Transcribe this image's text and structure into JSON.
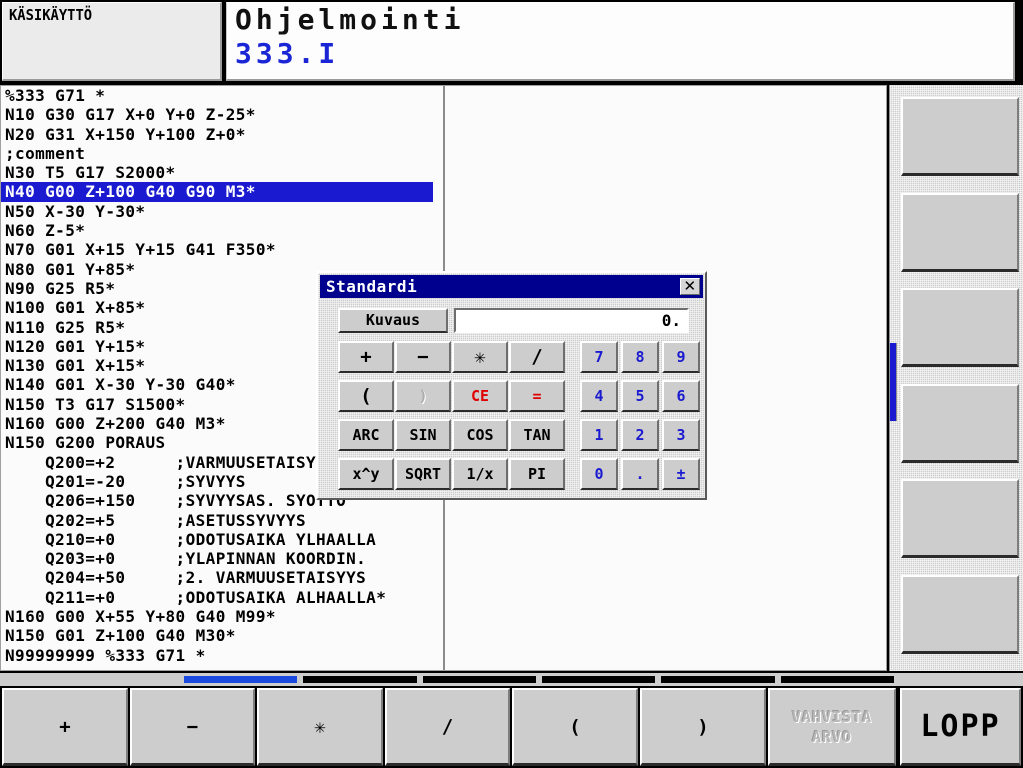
{
  "header": {
    "mode_label": "KÄSIKÄYTTÖ",
    "title": "Ohjelmointi",
    "subtitle": "333.I"
  },
  "program": {
    "lines": [
      {
        "text": "%333 G71 *",
        "selected": false
      },
      {
        "text": "N10 G30 G17 X+0 Y+0 Z-25*",
        "selected": false
      },
      {
        "text": "N20 G31 X+150 Y+100 Z+0*",
        "selected": false
      },
      {
        "text": ";comment",
        "selected": false
      },
      {
        "text": "N30 T5 G17 S2000*",
        "selected": false
      },
      {
        "text": "N40 G00 Z+100 G40 G90 M3*",
        "selected": true
      },
      {
        "text": "N50 X-30 Y-30*",
        "selected": false
      },
      {
        "text": "N60 Z-5*",
        "selected": false
      },
      {
        "text": "N70 G01 X+15 Y+15 G41 F350*",
        "selected": false
      },
      {
        "text": "N80 G01 Y+85*",
        "selected": false
      },
      {
        "text": "N90 G25 R5*",
        "selected": false
      },
      {
        "text": "N100 G01 X+85*",
        "selected": false
      },
      {
        "text": "N110 G25 R5*",
        "selected": false
      },
      {
        "text": "N120 G01 Y+15*",
        "selected": false
      },
      {
        "text": "N130 G01 X+15*",
        "selected": false
      },
      {
        "text": "N140 G01 X-30 Y-30 G40*",
        "selected": false
      },
      {
        "text": "N150 T3 G17 S1500*",
        "selected": false
      },
      {
        "text": "N160 G00 Z+200 G40 M3*",
        "selected": false
      },
      {
        "text": "N150 G200 PORAUS",
        "selected": false
      },
      {
        "text": "    Q200=+2      ;VARMUUSETAISYYS",
        "selected": false
      },
      {
        "text": "    Q201=-20     ;SYVYYS",
        "selected": false
      },
      {
        "text": "    Q206=+150    ;SYVYYSAS. SYOTTO",
        "selected": false
      },
      {
        "text": "    Q202=+5      ;ASETUSSYVYYS",
        "selected": false
      },
      {
        "text": "    Q210=+0      ;ODOTUSAIKA YLHAALLA",
        "selected": false
      },
      {
        "text": "    Q203=+0      ;YLAPINNAN KOORDIN.",
        "selected": false
      },
      {
        "text": "    Q204=+50     ;2. VARMUUSETAISYYS",
        "selected": false
      },
      {
        "text": "    Q211=+0      ;ODOTUSAIKA ALHAALLA*",
        "selected": false
      },
      {
        "text": "N160 G00 X+55 Y+80 G40 M99*",
        "selected": false
      },
      {
        "text": "N150 G01 Z+100 G40 M30*",
        "selected": false
      },
      {
        "text": "N99999999 %333 G71 *",
        "selected": false
      }
    ]
  },
  "calculator": {
    "title": "Standardi",
    "close_label": "✕",
    "description_button": "Kuvaus",
    "display_value": "0.",
    "operator_keys": [
      {
        "label": "+",
        "style": "big",
        "enabled": true
      },
      {
        "label": "−",
        "style": "big",
        "enabled": true
      },
      {
        "label": "✳",
        "style": "big",
        "enabled": true
      },
      {
        "label": "∕",
        "style": "big",
        "enabled": true
      },
      {
        "label": "(",
        "style": "big",
        "enabled": true
      },
      {
        "label": ")",
        "style": "dim",
        "enabled": false
      },
      {
        "label": "CE",
        "style": "red",
        "enabled": true
      },
      {
        "label": "=",
        "style": "red",
        "enabled": true
      },
      {
        "label": "ARC",
        "style": "",
        "enabled": true
      },
      {
        "label": "SIN",
        "style": "",
        "enabled": true
      },
      {
        "label": "COS",
        "style": "",
        "enabled": true
      },
      {
        "label": "TAN",
        "style": "",
        "enabled": true
      },
      {
        "label": "x^y",
        "style": "",
        "enabled": true
      },
      {
        "label": "SQRT",
        "style": "",
        "enabled": true
      },
      {
        "label": "1/x",
        "style": "",
        "enabled": true
      },
      {
        "label": "PI",
        "style": "",
        "enabled": true
      }
    ],
    "number_keys": [
      {
        "label": "7",
        "enabled": true
      },
      {
        "label": "8",
        "enabled": true
      },
      {
        "label": "9",
        "enabled": true
      },
      {
        "label": "4",
        "enabled": true
      },
      {
        "label": "5",
        "enabled": true
      },
      {
        "label": "6",
        "enabled": true
      },
      {
        "label": "1",
        "enabled": true
      },
      {
        "label": "2",
        "enabled": true
      },
      {
        "label": "3",
        "enabled": true
      },
      {
        "label": "0",
        "enabled": true
      },
      {
        "label": ".",
        "enabled": true
      },
      {
        "label": "±",
        "enabled": true
      }
    ]
  },
  "softkeys_bottom": [
    {
      "label": "+",
      "enabled": true,
      "size": "normal"
    },
    {
      "label": "−",
      "enabled": true,
      "size": "normal"
    },
    {
      "label": "✳",
      "enabled": true,
      "size": "normal"
    },
    {
      "label": "∕",
      "enabled": true,
      "size": "normal"
    },
    {
      "label": "(",
      "enabled": true,
      "size": "normal"
    },
    {
      "label": ")",
      "enabled": true,
      "size": "normal"
    },
    {
      "label": "VAHVISTA\nARVO",
      "enabled": false,
      "size": "normal"
    },
    {
      "label": "LOPP",
      "enabled": true,
      "size": "big"
    }
  ],
  "softkeys_right": [
    {
      "label": "",
      "enabled": true
    },
    {
      "label": "",
      "enabled": true
    },
    {
      "label": "",
      "enabled": true
    },
    {
      "label": "",
      "enabled": true
    },
    {
      "label": "",
      "enabled": true
    },
    {
      "label": "",
      "enabled": true
    }
  ],
  "indicator_strip": {
    "segments": [
      {
        "active": true
      },
      {
        "active": false
      },
      {
        "active": false
      },
      {
        "active": false
      },
      {
        "active": false
      },
      {
        "active": false
      }
    ]
  },
  "colors": {
    "accent_blue": "#1a1ad0",
    "title_blue": "#00008f",
    "panel_gray": "#cdcdcd",
    "error_red": "#e00000"
  }
}
